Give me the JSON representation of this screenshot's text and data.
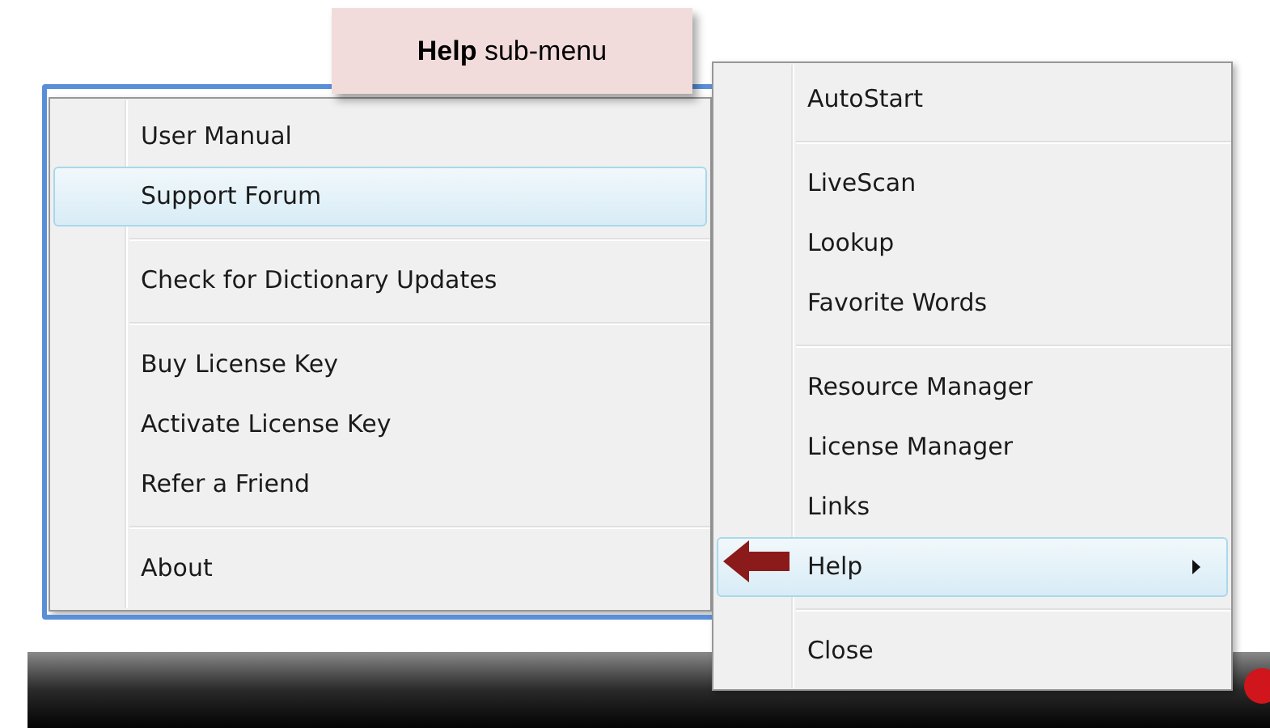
{
  "callout": {
    "text": "**Help** sub-menu"
  },
  "help_submenu": {
    "items": [
      {
        "kind": "item",
        "label": "User Manual",
        "selected": false
      },
      {
        "kind": "item",
        "label": "Support Forum",
        "selected": true
      },
      {
        "kind": "separator"
      },
      {
        "kind": "item",
        "label": "Check for Dictionary Updates",
        "selected": false
      },
      {
        "kind": "separator"
      },
      {
        "kind": "item",
        "label": "Buy License Key",
        "selected": false
      },
      {
        "kind": "item",
        "label": "Activate License Key",
        "selected": false
      },
      {
        "kind": "item",
        "label": "Refer a Friend",
        "selected": false
      },
      {
        "kind": "separator"
      },
      {
        "kind": "item",
        "label": "About",
        "selected": false
      }
    ]
  },
  "context_menu": {
    "items": [
      {
        "kind": "item",
        "label": "AutoStart",
        "selected": false,
        "has_submenu": false
      },
      {
        "kind": "separator"
      },
      {
        "kind": "item",
        "label": "LiveScan",
        "selected": false,
        "has_submenu": false
      },
      {
        "kind": "item",
        "label": "Lookup",
        "selected": false,
        "has_submenu": false
      },
      {
        "kind": "item",
        "label": "Favorite Words",
        "selected": false,
        "has_submenu": false
      },
      {
        "kind": "separator"
      },
      {
        "kind": "item",
        "label": "Resource Manager",
        "selected": false,
        "has_submenu": false
      },
      {
        "kind": "item",
        "label": "License Manager",
        "selected": false,
        "has_submenu": false
      },
      {
        "kind": "item",
        "label": "Links",
        "selected": false,
        "has_submenu": false
      },
      {
        "kind": "item",
        "label": "Help",
        "selected": true,
        "has_submenu": true
      },
      {
        "kind": "separator"
      },
      {
        "kind": "item",
        "label": "Close",
        "selected": false,
        "has_submenu": false
      }
    ]
  }
}
